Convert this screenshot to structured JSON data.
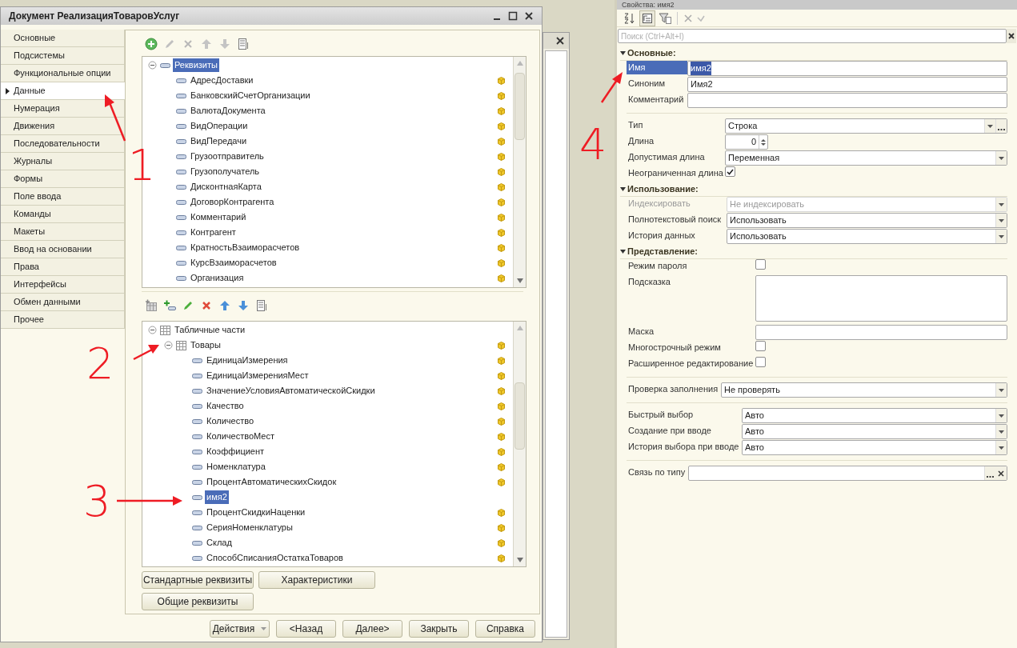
{
  "main_window": {
    "title": "Документ РеализацияТоваровУслуг",
    "nav": [
      {
        "label": "Основные",
        "selected": false
      },
      {
        "label": "Подсистемы",
        "selected": false
      },
      {
        "label": "Функциональные опции",
        "selected": false
      },
      {
        "label": "Данные",
        "selected": true
      },
      {
        "label": "Нумерация",
        "selected": false
      },
      {
        "label": "Движения",
        "selected": false
      },
      {
        "label": "Последовательности",
        "selected": false
      },
      {
        "label": "Журналы",
        "selected": false
      },
      {
        "label": "Формы",
        "selected": false
      },
      {
        "label": "Поле ввода",
        "selected": false
      },
      {
        "label": "Команды",
        "selected": false
      },
      {
        "label": "Макеты",
        "selected": false
      },
      {
        "label": "Ввод на основании",
        "selected": false
      },
      {
        "label": "Права",
        "selected": false
      },
      {
        "label": "Интерфейсы",
        "selected": false
      },
      {
        "label": "Обмен данными",
        "selected": false
      },
      {
        "label": "Прочее",
        "selected": false
      }
    ],
    "attributes_tree": [
      {
        "label": "Реквизиты",
        "kind": "group",
        "expanded": true,
        "selected": true,
        "flag": false,
        "children": [
          {
            "label": "АдресДоставки",
            "kind": "attribute",
            "selected": false,
            "flag": true
          },
          {
            "label": "БанковскийСчетОрганизации",
            "kind": "attribute",
            "selected": false,
            "flag": true
          },
          {
            "label": "ВалютаДокумента",
            "kind": "attribute",
            "selected": false,
            "flag": true
          },
          {
            "label": "ВидОперации",
            "kind": "attribute",
            "selected": false,
            "flag": true
          },
          {
            "label": "ВидПередачи",
            "kind": "attribute",
            "selected": false,
            "flag": true
          },
          {
            "label": "Грузоотправитель",
            "kind": "attribute",
            "selected": false,
            "flag": true
          },
          {
            "label": "Грузополучатель",
            "kind": "attribute",
            "selected": false,
            "flag": true
          },
          {
            "label": "ДисконтнаяКарта",
            "kind": "attribute",
            "selected": false,
            "flag": true
          },
          {
            "label": "ДоговорКонтрагента",
            "kind": "attribute",
            "selected": false,
            "flag": true
          },
          {
            "label": "Комментарий",
            "kind": "attribute",
            "selected": false,
            "flag": true
          },
          {
            "label": "Контрагент",
            "kind": "attribute",
            "selected": false,
            "flag": true
          },
          {
            "label": "КратностьВзаиморасчетов",
            "kind": "attribute",
            "selected": false,
            "flag": true
          },
          {
            "label": "КурсВзаиморасчетов",
            "kind": "attribute",
            "selected": false,
            "flag": true
          },
          {
            "label": "Организация",
            "kind": "attribute",
            "selected": false,
            "flag": true
          }
        ]
      }
    ],
    "tables_tree": [
      {
        "label": "Табличные части",
        "kind": "table",
        "expanded": true,
        "selected": false,
        "flag": false,
        "children": [
          {
            "label": "Товары",
            "kind": "table",
            "expanded": true,
            "selected": false,
            "flag": true,
            "children": [
              {
                "label": "ЕдиницаИзмерения",
                "kind": "attribute",
                "selected": false,
                "flag": true
              },
              {
                "label": "ЕдиницаИзмеренияМест",
                "kind": "attribute",
                "selected": false,
                "flag": true
              },
              {
                "label": "ЗначениеУсловияАвтоматическойСкидки",
                "kind": "attribute",
                "selected": false,
                "flag": true
              },
              {
                "label": "Качество",
                "kind": "attribute",
                "selected": false,
                "flag": true
              },
              {
                "label": "Количество",
                "kind": "attribute",
                "selected": false,
                "flag": true
              },
              {
                "label": "КоличествоМест",
                "kind": "attribute",
                "selected": false,
                "flag": true
              },
              {
                "label": "Коэффициент",
                "kind": "attribute",
                "selected": false,
                "flag": true
              },
              {
                "label": "Номенклатура",
                "kind": "attribute",
                "selected": false,
                "flag": true
              },
              {
                "label": "ПроцентАвтоматическихСкидок",
                "kind": "attribute",
                "selected": false,
                "flag": true
              },
              {
                "label": "имя2",
                "kind": "attribute",
                "selected": true,
                "flag": false
              },
              {
                "label": "ПроцентСкидкиНаценки",
                "kind": "attribute",
                "selected": false,
                "flag": true
              },
              {
                "label": "СерияНоменклатуры",
                "kind": "attribute",
                "selected": false,
                "flag": true
              },
              {
                "label": "Склад",
                "kind": "attribute",
                "selected": false,
                "flag": true
              },
              {
                "label": "СпособСписанияОстаткаТоваров",
                "kind": "attribute",
                "selected": false,
                "flag": true
              }
            ]
          }
        ]
      }
    ],
    "panel_buttons": [
      "Стандартные реквизиты",
      "Характеристики",
      "Общие реквизиты"
    ],
    "footer_buttons": [
      {
        "label": "Действия",
        "kind": "menu"
      },
      {
        "label": "<Назад",
        "kind": "plain"
      },
      {
        "label": "Далее>",
        "kind": "plain"
      },
      {
        "label": "Закрыть",
        "kind": "plain"
      },
      {
        "label": "Справка",
        "kind": "plain"
      }
    ]
  },
  "properties": {
    "title": "Свойства: имя2",
    "search": {
      "placeholder": "Поиск (Ctrl+Alt+I)"
    },
    "sections": [
      {
        "title": "Основные:",
        "rows": [
          {
            "kind": "text",
            "label": "Имя",
            "value": "имя2",
            "selected": true,
            "disabled": false
          },
          {
            "kind": "text",
            "label": "Синоним",
            "value": "Имя2",
            "selected": false,
            "disabled": false
          },
          {
            "kind": "text",
            "label": "Комментарий",
            "selected": false,
            "disabled": false
          }
        ]
      },
      {
        "rows": [
          {
            "kind": "type",
            "label": "Тип",
            "value": "Строка",
            "selected": false,
            "disabled": false
          },
          {
            "kind": "number",
            "label": "Длина",
            "value": "0",
            "selected": false,
            "disabled": false
          },
          {
            "kind": "combo",
            "label": "Допустимая длина",
            "value": "Переменная",
            "selected": false,
            "disabled": false
          },
          {
            "kind": "checkbox",
            "label": "Неограниченная длина",
            "checked": true,
            "selected": false,
            "disabled": false
          }
        ]
      },
      {
        "title": "Использование:",
        "rows": [
          {
            "kind": "combo",
            "label": "Индексировать",
            "value": "Не индексировать",
            "selected": false,
            "disabled": true
          },
          {
            "kind": "combo",
            "label": "Полнотекстовый поиск",
            "value": "Использовать",
            "selected": false,
            "disabled": false
          },
          {
            "kind": "combo",
            "label": "История данных",
            "value": "Использовать",
            "selected": false,
            "disabled": false
          }
        ]
      },
      {
        "title": "Представление:",
        "rows": [
          {
            "kind": "checkbox",
            "label": "Режим пароля",
            "checked": false,
            "selected": false,
            "disabled": false
          },
          {
            "kind": "memo",
            "label": "Подсказка",
            "selected": false,
            "disabled": false
          },
          {
            "kind": "text",
            "label": "Маска",
            "selected": false,
            "disabled": false
          },
          {
            "kind": "checkbox",
            "label": "Многострочный режим",
            "checked": false,
            "selected": false,
            "disabled": false
          },
          {
            "kind": "checkbox",
            "label": "Расширенное редактирование",
            "checked": false,
            "selected": false,
            "disabled": false
          }
        ]
      },
      {
        "rows": [
          {
            "kind": "combo",
            "label": "Проверка заполнения",
            "value": "Не проверять",
            "selected": false,
            "disabled": false
          }
        ]
      },
      {
        "rows": [
          {
            "kind": "combo",
            "label": "Быстрый выбор",
            "value": "Авто",
            "selected": false,
            "disabled": false
          },
          {
            "kind": "combo",
            "label": "Создание при вводе",
            "value": "Авто",
            "selected": false,
            "disabled": false
          },
          {
            "kind": "combo",
            "label": "История выбора при вводе",
            "value": "Авто",
            "selected": false,
            "disabled": false
          }
        ]
      },
      {
        "rows": [
          {
            "kind": "link",
            "label": "Связь по типу",
            "selected": false,
            "disabled": false
          }
        ]
      }
    ]
  },
  "annotations": [
    "1",
    "2",
    "3",
    "4"
  ]
}
